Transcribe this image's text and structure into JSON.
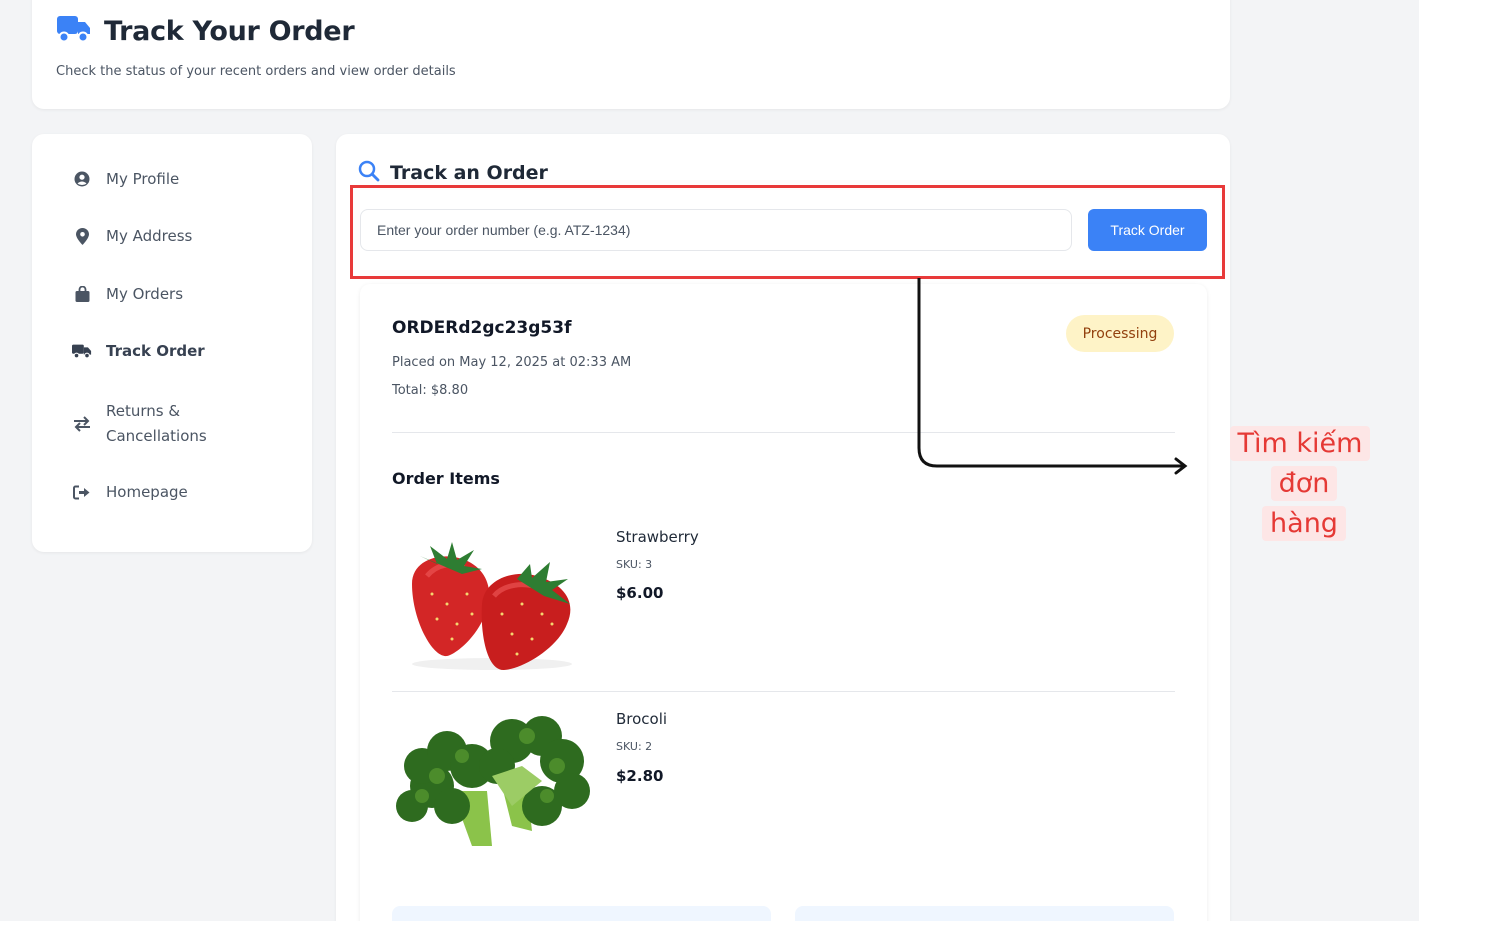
{
  "header": {
    "title": "Track Your Order",
    "subtitle": "Check the status of your recent orders and view order details",
    "icon": "truck-icon"
  },
  "sidebar": {
    "items": [
      {
        "label": "My Profile",
        "icon": "user-circle-icon",
        "active": false
      },
      {
        "label": "My Address",
        "icon": "map-pin-icon",
        "active": false
      },
      {
        "label": "My Orders",
        "icon": "shopping-bag-icon",
        "active": false
      },
      {
        "label": "Track Order",
        "icon": "truck-icon",
        "active": true
      },
      {
        "label": "Returns & Cancellations",
        "icon": "exchange-icon",
        "active": false
      },
      {
        "label": "Homepage",
        "icon": "sign-out-icon",
        "active": false
      }
    ]
  },
  "track": {
    "title": "Track an Order",
    "placeholder": "Enter your order number (e.g. ATZ-1234)",
    "button_label": "Track Order"
  },
  "order": {
    "id": "ORDERd2gc23g53f",
    "status": "Processing",
    "placed": "Placed on May 12, 2025 at 02:33 AM",
    "total": "Total: $8.80",
    "items_title": "Order Items",
    "items": [
      {
        "name": "Strawberry",
        "sku": "SKU: 3",
        "price": "$6.00",
        "image": "strawberry-image"
      },
      {
        "name": "Brocoli",
        "sku": "SKU: 2",
        "price": "$2.80",
        "image": "broccoli-image"
      }
    ]
  },
  "annotation": {
    "line1": "Tìm kiếm đơn",
    "line2": "hàng"
  },
  "colors": {
    "accent": "#3b82f6",
    "highlight": "#e83a3a",
    "badge_bg": "#fef3c7",
    "badge_text": "#92400e",
    "annotation_text": "#e53935",
    "background": "#f3f4f6"
  }
}
